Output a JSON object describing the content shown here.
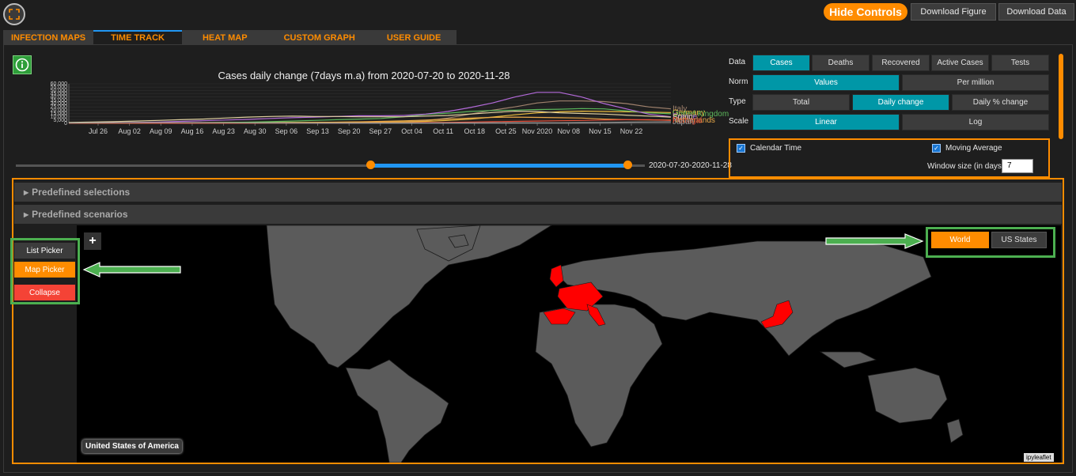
{
  "topbar": {
    "fullscreen_icon": "fullscreen-icon",
    "hide_controls": "Hide Controls",
    "download_figure": "Download Figure",
    "download_data": "Download Data"
  },
  "tabs": [
    {
      "label": "INFECTION MAPS",
      "active": false
    },
    {
      "label": "TIME TRACK",
      "active": true
    },
    {
      "label": "HEAT MAP",
      "active": false
    },
    {
      "label": "CUSTOM GRAPH",
      "active": false
    },
    {
      "label": "USER GUIDE",
      "active": false
    }
  ],
  "info_icon": "info-icon",
  "chart_data": {
    "type": "line",
    "title": "Cases daily change (7days m.a) from 2020-07-20 to 2020-11-28",
    "x_ticks": [
      "Jul 26",
      "Aug 02",
      "Aug 09",
      "Aug 16",
      "Aug 23",
      "Aug 30",
      "Sep 06",
      "Sep 13",
      "Sep 20",
      "Sep 27",
      "Oct 04",
      "Oct 11",
      "Oct 18",
      "Oct 25",
      "Nov 2020",
      "Nov 08",
      "Nov 15",
      "Nov 22"
    ],
    "y_ticks": [
      "0",
      "5,000",
      "10,000",
      "15,000",
      "20,000",
      "25,000",
      "30,000",
      "35,000",
      "40,000",
      "45,000",
      "50,000",
      "55,000",
      "60,000"
    ],
    "ylim": [
      0,
      60000
    ],
    "series": [
      {
        "name": "Italy",
        "color": "#a0826d",
        "values": [
          300,
          300,
          350,
          400,
          450,
          500,
          700,
          1000,
          1400,
          1600,
          1500,
          1500,
          1600,
          1800,
          2000,
          2500,
          4000,
          8000,
          14000,
          20000,
          25000,
          31000,
          34000,
          34000,
          33000,
          30000,
          25000,
          22000
        ]
      },
      {
        "name": "Germany",
        "color": "#f0c040",
        "values": [
          400,
          500,
          600,
          700,
          900,
          1100,
          1200,
          1300,
          1300,
          1200,
          1300,
          1500,
          1700,
          1900,
          2000,
          2200,
          3000,
          4500,
          6500,
          9500,
          13000,
          16000,
          17500,
          18500,
          18000,
          17500,
          17000,
          16500
        ]
      },
      {
        "name": "United Kingdom",
        "color": "#5cb85c",
        "values": [
          600,
          650,
          700,
          800,
          900,
          1000,
          1100,
          1300,
          1800,
          2500,
          3500,
          4500,
          5500,
          6500,
          7500,
          10000,
          13500,
          15500,
          18000,
          19500,
          20000,
          21000,
          21500,
          22500,
          22000,
          19000,
          16000,
          14500
        ]
      },
      {
        "name": "France",
        "color": "#b36ad9",
        "values": [
          700,
          900,
          1100,
          1500,
          2000,
          3000,
          4000,
          5000,
          6000,
          7500,
          8500,
          9500,
          10500,
          11500,
          11500,
          12000,
          14000,
          18000,
          24000,
          31000,
          40000,
          47000,
          47000,
          40000,
          30000,
          22000,
          14000,
          10000
        ]
      },
      {
        "name": "Spain",
        "color": "#e0d0a0",
        "values": [
          1500,
          2000,
          2500,
          3500,
          4500,
          5500,
          6500,
          8000,
          9500,
          10500,
          11000,
          10500,
          10500,
          10000,
          10000,
          10000,
          11000,
          12000,
          14000,
          16500,
          18500,
          18000,
          16000,
          15000,
          14000,
          12500,
          11000,
          9500
        ]
      },
      {
        "name": "Netherlands",
        "color": "#e8a848",
        "values": [
          100,
          150,
          200,
          300,
          400,
          450,
          500,
          550,
          600,
          700,
          900,
          1300,
          1800,
          2300,
          3000,
          3800,
          5000,
          6500,
          8000,
          9000,
          9500,
          9000,
          8500,
          8000,
          6500,
          5500,
          5200,
          5000
        ]
      },
      {
        "name": "Portugal",
        "color": "#e8503c",
        "values": [
          200,
          200,
          200,
          200,
          200,
          200,
          200,
          250,
          300,
          350,
          400,
          450,
          500,
          600,
          700,
          900,
          1200,
          1500,
          2000,
          2500,
          3000,
          3500,
          4000,
          4500,
          5000,
          5500,
          5500,
          4500
        ]
      },
      {
        "name": "Japan",
        "color": "#9e9e9e",
        "values": [
          600,
          800,
          1000,
          1200,
          1300,
          1200,
          1100,
          1000,
          900,
          700,
          600,
          500,
          500,
          500,
          500,
          500,
          500,
          600,
          600,
          700,
          700,
          800,
          900,
          1200,
          1500,
          1800,
          2100,
          2300
        ]
      }
    ]
  },
  "date_range": {
    "readout": "2020-07-20-2020-11-28",
    "start_fraction": 0.0,
    "end_fraction": 1.0
  },
  "controls": {
    "data": {
      "label": "Data",
      "options": [
        "Cases",
        "Deaths",
        "Recovered",
        "Active Cases",
        "Tests"
      ],
      "selected": 0
    },
    "norm": {
      "label": "Norm",
      "options": [
        "Values",
        "Per million"
      ],
      "selected": 0
    },
    "type": {
      "label": "Type",
      "options": [
        "Total",
        "Daily change",
        "Daily % change"
      ],
      "selected": 1
    },
    "scale": {
      "label": "Scale",
      "options": [
        "Linear",
        "Log"
      ],
      "selected": 0
    },
    "calendar_time": {
      "label": "Calendar Time",
      "checked": true
    },
    "moving_average": {
      "label": "Moving Average",
      "checked": true
    },
    "window_size": {
      "label": "Window size (in days)",
      "value": "7"
    }
  },
  "accordions": [
    "Predefined selections",
    "Predefined scenarios"
  ],
  "picker": {
    "list": "List Picker",
    "map": "Map Picker",
    "collapse": "Collapse",
    "zoom_in": "+"
  },
  "map_scope": {
    "world": "World",
    "us": "US States"
  },
  "map": {
    "hover_country": "United States of America",
    "attribution": "ipyleaflet",
    "selected_color": "#ff0000",
    "land_color": "#5b5b5b"
  }
}
